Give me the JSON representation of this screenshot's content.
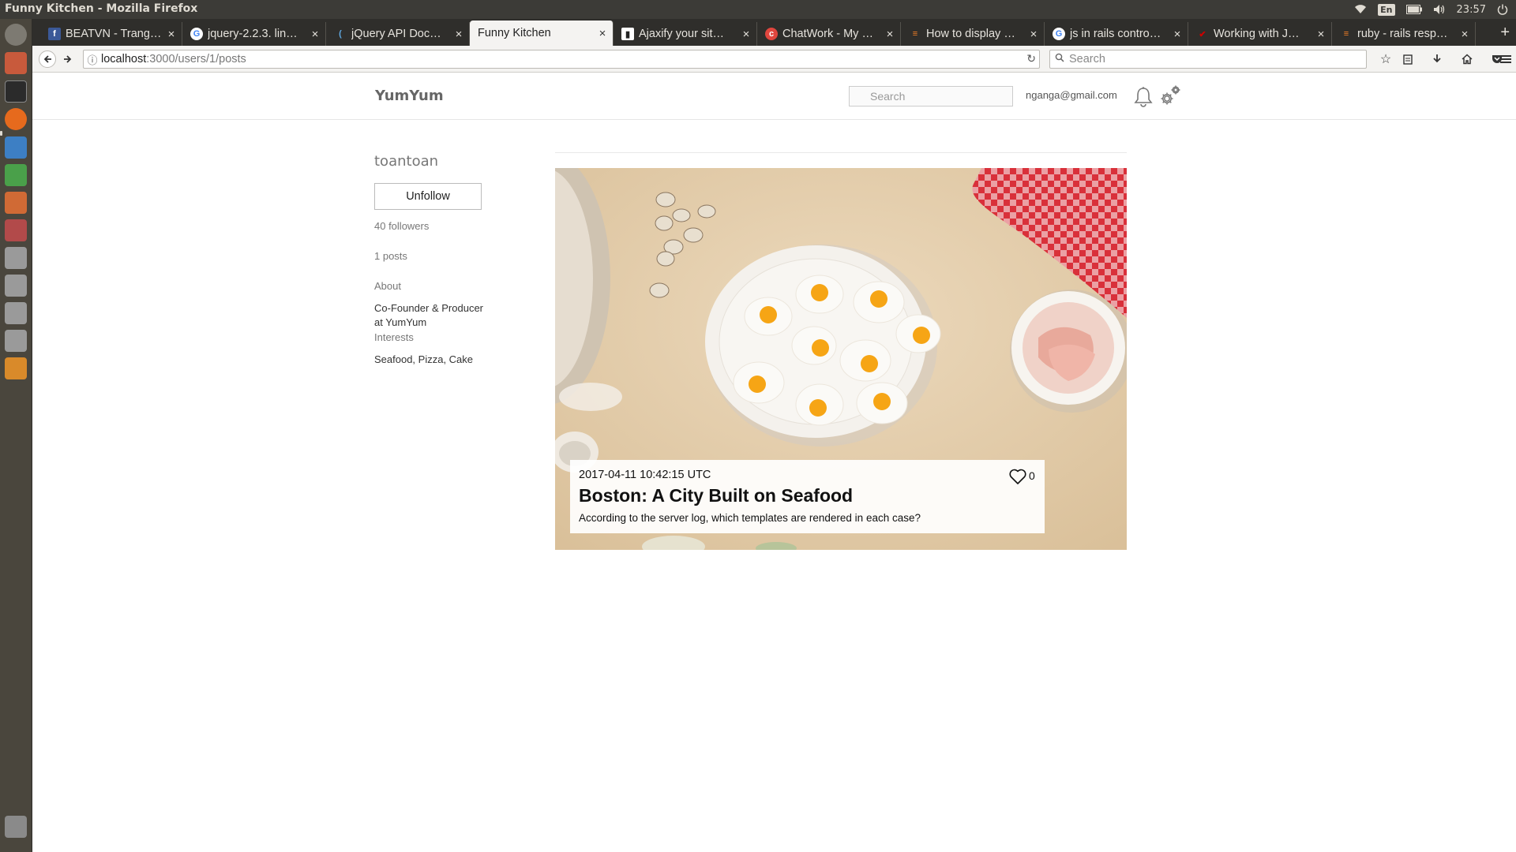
{
  "window": {
    "title": "Funny Kitchen - Mozilla Firefox"
  },
  "panel": {
    "lang": "En",
    "clock": "23:57"
  },
  "tabs": [
    {
      "label": "BEATVN - Trang…",
      "icon": "facebook-icon"
    },
    {
      "label": "jquery-2.2.3. lin…",
      "icon": "google-icon"
    },
    {
      "label": "jQuery API Doc…",
      "icon": "jquery-icon"
    },
    {
      "label": "Funny Kitchen",
      "icon": "none",
      "active": true
    },
    {
      "label": "Ajaxify your sit…",
      "icon": "bookmark-icon"
    },
    {
      "label": "ChatWork - My …",
      "icon": "chatwork-icon"
    },
    {
      "label": "How to display …",
      "icon": "stackoverflow-icon"
    },
    {
      "label": "js in rails contro…",
      "icon": "google-icon"
    },
    {
      "label": "Working with J…",
      "icon": "rails-icon"
    },
    {
      "label": "ruby - rails resp…",
      "icon": "stackoverflow-icon"
    }
  ],
  "urlbar": {
    "host": "localhost",
    "path": ":3000/users/1/posts"
  },
  "browser_search": {
    "placeholder": "Search"
  },
  "site": {
    "brand": "YumYum",
    "search_placeholder": "Search",
    "user_email": "nganga@gmail.com"
  },
  "profile": {
    "name": "toantoan",
    "unfollow_label": "Unfollow",
    "followers": "40 followers",
    "posts": "1 posts",
    "about_label": "About",
    "about_text": "Co-Founder & Producer at YumYum",
    "interests_label": "Interests",
    "interests_text": "Seafood, Pizza, Cake"
  },
  "post": {
    "date": "2017-04-11 10:42:15 UTC",
    "title": "Boston: A City Built on Seafood",
    "excerpt": "According to the server log, which templates are rendered in each case?",
    "likes": "0"
  }
}
